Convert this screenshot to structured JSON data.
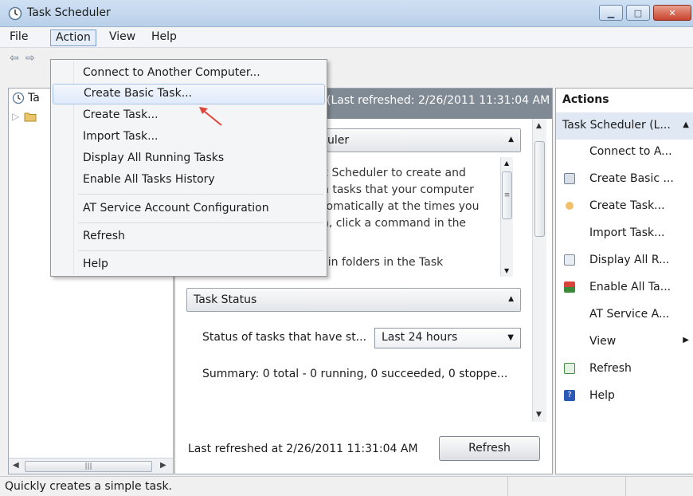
{
  "window": {
    "title": "Task Scheduler"
  },
  "menubar": {
    "items": [
      "File",
      "Action",
      "View",
      "Help"
    ]
  },
  "tree": {
    "root_label": "Ta"
  },
  "center": {
    "header_text": "(Last refreshed: 2/26/2011 11:31:04 AM",
    "overview_title": "uler",
    "overview_lines": [
      "k Scheduler to create and",
      "n tasks that your computer",
      "tomatically at the times you",
      "n, click a command in the"
    ],
    "overview_cut_line": "Tasks are stored in folders in the Task",
    "task_status_title": "Task Status",
    "status_label": "Status of tasks that have st...",
    "status_select_value": "Last 24 hours",
    "summary": "Summary: 0 total - 0 running, 0 succeeded, 0 stoppe...",
    "last_refreshed": "Last refreshed at 2/26/2011 11:31:04 AM",
    "refresh_button": "Refresh"
  },
  "actions": {
    "title": "Actions",
    "group_label": "Task Scheduler (L...",
    "items": [
      {
        "label": "Connect to A...",
        "icon": "none"
      },
      {
        "label": "Create Basic ...",
        "icon": "create-basic-task-icon"
      },
      {
        "label": "Create Task...",
        "icon": "create-task-icon"
      },
      {
        "label": "Import Task...",
        "icon": "none"
      },
      {
        "label": "Display All R...",
        "icon": "display-running-tasks-icon"
      },
      {
        "label": "Enable All Ta...",
        "icon": "enable-history-icon"
      },
      {
        "label": "AT Service A...",
        "icon": "none"
      },
      {
        "label": "View",
        "icon": "none"
      },
      {
        "label": "Refresh",
        "icon": "refresh-icon"
      },
      {
        "label": "Help",
        "icon": "help-icon"
      }
    ]
  },
  "dropdown": {
    "items": [
      "Connect to Another Computer...",
      "Create Basic Task...",
      "Create Task...",
      "Import Task...",
      "Display All Running Tasks",
      "Enable All Tasks History",
      "AT Service Account Configuration",
      "Refresh",
      "Help"
    ],
    "highlighted": "Create Basic Task..."
  },
  "statusbar": {
    "text": "Quickly creates a simple task."
  },
  "colors": {
    "title_bar": "#c4d7ee",
    "center_header": "#808a94",
    "close_button": "#c7442d",
    "pointer_arrow": "#e0453a"
  }
}
